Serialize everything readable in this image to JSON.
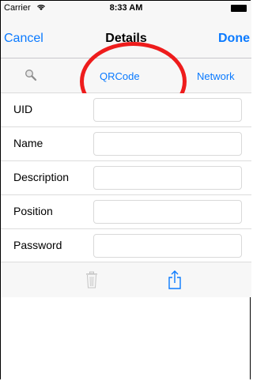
{
  "status": {
    "carrier": "Carrier",
    "time": "8:33 AM"
  },
  "nav": {
    "cancel": "Cancel",
    "title": "Details",
    "done": "Done"
  },
  "segments": {
    "qrcode": "QRCode",
    "network": "Network"
  },
  "form": {
    "rows": [
      {
        "label": "UID",
        "value": ""
      },
      {
        "label": "Name",
        "value": ""
      },
      {
        "label": "Description",
        "value": ""
      },
      {
        "label": "Position",
        "value": ""
      },
      {
        "label": "Password",
        "value": ""
      }
    ]
  },
  "colors": {
    "accent": "#0a7aff",
    "annotation": "#ee1c1c"
  },
  "icons": [
    "search-icon",
    "trash-icon",
    "share-icon",
    "wifi-icon",
    "battery-icon"
  ]
}
